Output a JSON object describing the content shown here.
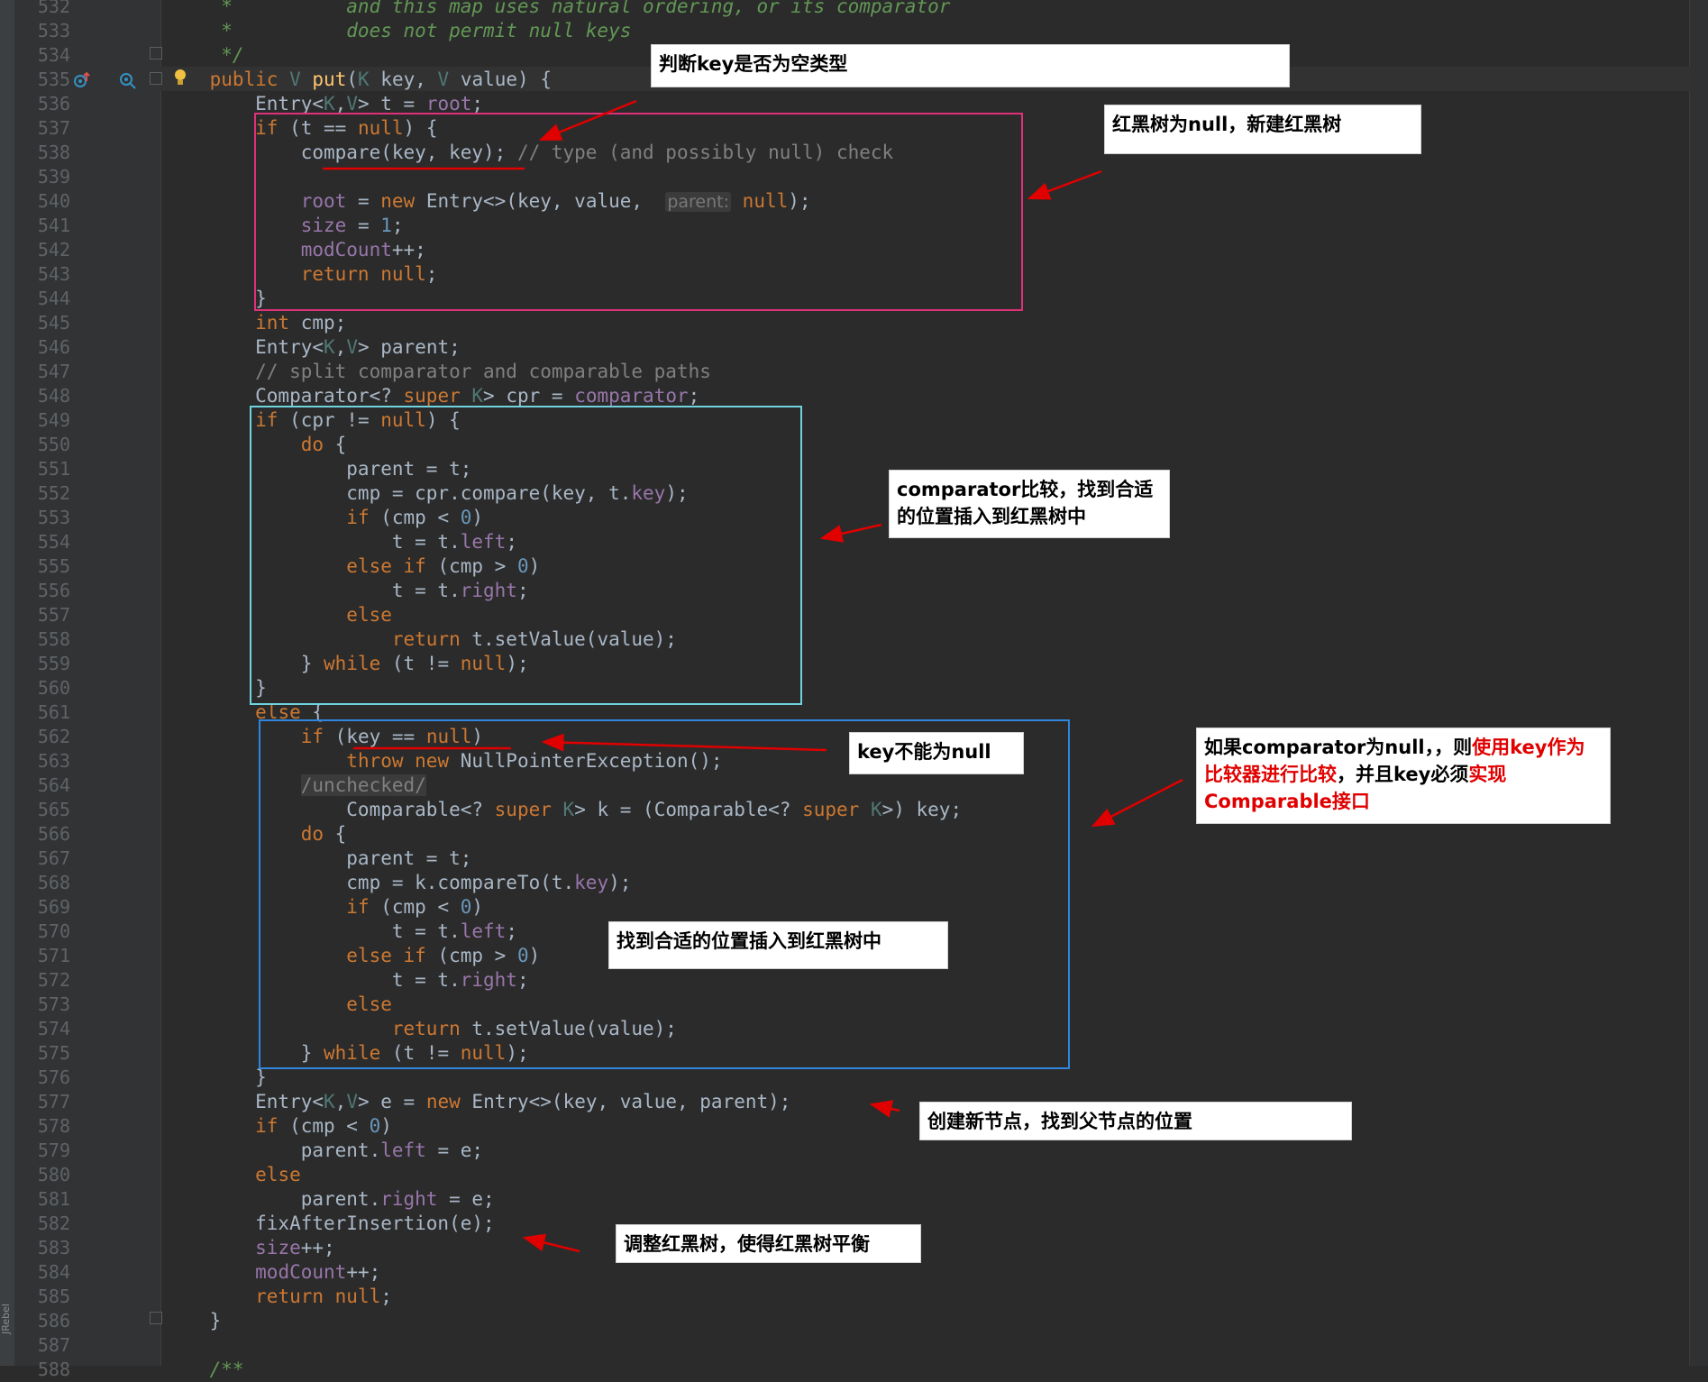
{
  "editor": {
    "lines": [
      {
        "n": "532",
        "html": "<span class='doc'>     *          and this map uses natural ordering, or its comparator</span>"
      },
      {
        "n": "533",
        "html": "<span class='doc'>     *          does not permit null keys</span>"
      },
      {
        "n": "534",
        "html": "<span class='doc'>     */</span>"
      },
      {
        "n": "535",
        "html": "    <span class='kw'>public</span> <span class='tp'>V</span> <span class='fn'>put</span>(<span class='tp'>K</span> key, <span class='tp'>V</span> value) {"
      },
      {
        "n": "536",
        "html": "        Entry&lt;<span class='tp'>K</span>,<span class='tp'>V</span>&gt; t = <span class='fld'>root</span>;"
      },
      {
        "n": "537",
        "html": "        <span class='kw'>if</span> (t == <span class='kw'>null</span>) {"
      },
      {
        "n": "538",
        "html": "            compare(key, key); <span class='cmt'>// type (and possibly null) check</span>"
      },
      {
        "n": "539",
        "html": ""
      },
      {
        "n": "540",
        "html": "            <span class='fld'>root</span> = <span class='kw'>new</span> Entry&lt;&gt;(key, value,  <span class='hint'>parent:</span> <span class='kw'>null</span>);"
      },
      {
        "n": "541",
        "html": "            <span class='fld'>size</span> = <span class='num'>1</span>;"
      },
      {
        "n": "542",
        "html": "            <span class='fld'>modCount</span>++;"
      },
      {
        "n": "543",
        "html": "            <span class='kw'>return null</span>;"
      },
      {
        "n": "544",
        "html": "        }"
      },
      {
        "n": "545",
        "html": "        <span class='kw'>int</span> cmp;"
      },
      {
        "n": "546",
        "html": "        Entry&lt;<span class='tp'>K</span>,<span class='tp'>V</span>&gt; parent;"
      },
      {
        "n": "547",
        "html": "        <span class='cmt'>// split comparator and comparable paths</span>"
      },
      {
        "n": "548",
        "html": "        Comparator&lt;? <span class='kw'>super</span> <span class='tp'>K</span>&gt; cpr = <span class='fld'>comparator</span>;"
      },
      {
        "n": "549",
        "html": "        <span class='kw'>if</span> (cpr != <span class='kw'>null</span>) {"
      },
      {
        "n": "550",
        "html": "            <span class='kw'>do</span> {"
      },
      {
        "n": "551",
        "html": "                parent = t;"
      },
      {
        "n": "552",
        "html": "                cmp = cpr.compare(key, t.<span class='fld'>key</span>);"
      },
      {
        "n": "553",
        "html": "                <span class='kw'>if</span> (cmp &lt; <span class='num'>0</span>)"
      },
      {
        "n": "554",
        "html": "                    t = t.<span class='fld'>left</span>;"
      },
      {
        "n": "555",
        "html": "                <span class='kw'>else if</span> (cmp &gt; <span class='num'>0</span>)"
      },
      {
        "n": "556",
        "html": "                    t = t.<span class='fld'>right</span>;"
      },
      {
        "n": "557",
        "html": "                <span class='kw'>else</span>"
      },
      {
        "n": "558",
        "html": "                    <span class='kw'>return</span> t.setValue(value);"
      },
      {
        "n": "559",
        "html": "            } <span class='kw'>while</span> (t != <span class='kw'>null</span>);"
      },
      {
        "n": "560",
        "html": "        }"
      },
      {
        "n": "561",
        "html": "        <span class='kw'>else</span> {"
      },
      {
        "n": "562",
        "html": "            <span class='kw'>if</span> (key == <span class='kw'>null</span>)"
      },
      {
        "n": "563",
        "html": "                <span class='kw'>throw new</span> NullPointerException();"
      },
      {
        "n": "564",
        "html": "            <span class='sup cmt'>/unchecked/</span>"
      },
      {
        "n": "565",
        "html": "                Comparable&lt;? <span class='kw'>super</span> <span class='tp'>K</span>&gt; k = (Comparable&lt;? <span class='kw'>super</span> <span class='tp'>K</span>&gt;) key;"
      },
      {
        "n": "566",
        "html": "            <span class='kw'>do</span> {"
      },
      {
        "n": "567",
        "html": "                parent = t;"
      },
      {
        "n": "568",
        "html": "                cmp = k.compareTo(t.<span class='fld'>key</span>);"
      },
      {
        "n": "569",
        "html": "                <span class='kw'>if</span> (cmp &lt; <span class='num'>0</span>)"
      },
      {
        "n": "570",
        "html": "                    t = t.<span class='fld'>left</span>;"
      },
      {
        "n": "571",
        "html": "                <span class='kw'>else if</span> (cmp &gt; <span class='num'>0</span>)"
      },
      {
        "n": "572",
        "html": "                    t = t.<span class='fld'>right</span>;"
      },
      {
        "n": "573",
        "html": "                <span class='kw'>else</span>"
      },
      {
        "n": "574",
        "html": "                    <span class='kw'>return</span> t.setValue(value);"
      },
      {
        "n": "575",
        "html": "            } <span class='kw'>while</span> (t != <span class='kw'>null</span>);"
      },
      {
        "n": "576",
        "html": "        }"
      },
      {
        "n": "577",
        "html": "        Entry&lt;<span class='tp'>K</span>,<span class='tp'>V</span>&gt; e = <span class='kw'>new</span> Entry&lt;&gt;(key, value, parent);"
      },
      {
        "n": "578",
        "html": "        <span class='kw'>if</span> (cmp &lt; <span class='num'>0</span>)"
      },
      {
        "n": "579",
        "html": "            parent.<span class='fld'>left</span> = e;"
      },
      {
        "n": "580",
        "html": "        <span class='kw'>else</span>"
      },
      {
        "n": "581",
        "html": "            parent.<span class='fld'>right</span> = e;"
      },
      {
        "n": "582",
        "html": "        fixAfterInsertion(e);"
      },
      {
        "n": "583",
        "html": "        <span class='fld'>size</span>++;"
      },
      {
        "n": "584",
        "html": "        <span class='fld'>modCount</span>++;"
      },
      {
        "n": "585",
        "html": "        <span class='kw'>return null</span>;"
      },
      {
        "n": "586",
        "html": "    }"
      },
      {
        "n": "587",
        "html": ""
      },
      {
        "n": "588",
        "html": "    <span class='doc'>/**</span>"
      }
    ]
  },
  "callouts": {
    "c1": "判断key是否为空类型",
    "c2": "红黑树为null，新建红黑树",
    "c3": "comparator比较，找到合适的位置插入到红黑树中",
    "c4": "key不能为null",
    "c5_pre": "如果comparator为null，，则",
    "c5_red1": "使用key作为比较器进行比较",
    "c5_mid": "，并且key必须",
    "c5_red2": "实现Comparable接口",
    "c6": "找到合适的位置插入到红黑树中",
    "c7": "创建新节点，找到父节点的位置",
    "c8": "调整红黑树，使得红黑树平衡"
  },
  "sidebar": {
    "plugin_label": "JRebel"
  },
  "colors": {
    "background": "#2b2b2b",
    "box_magenta": "#e0307a",
    "box_cyan": "#6fd4e0",
    "box_blue": "#2e86de",
    "arrow_red": "#e00000"
  }
}
